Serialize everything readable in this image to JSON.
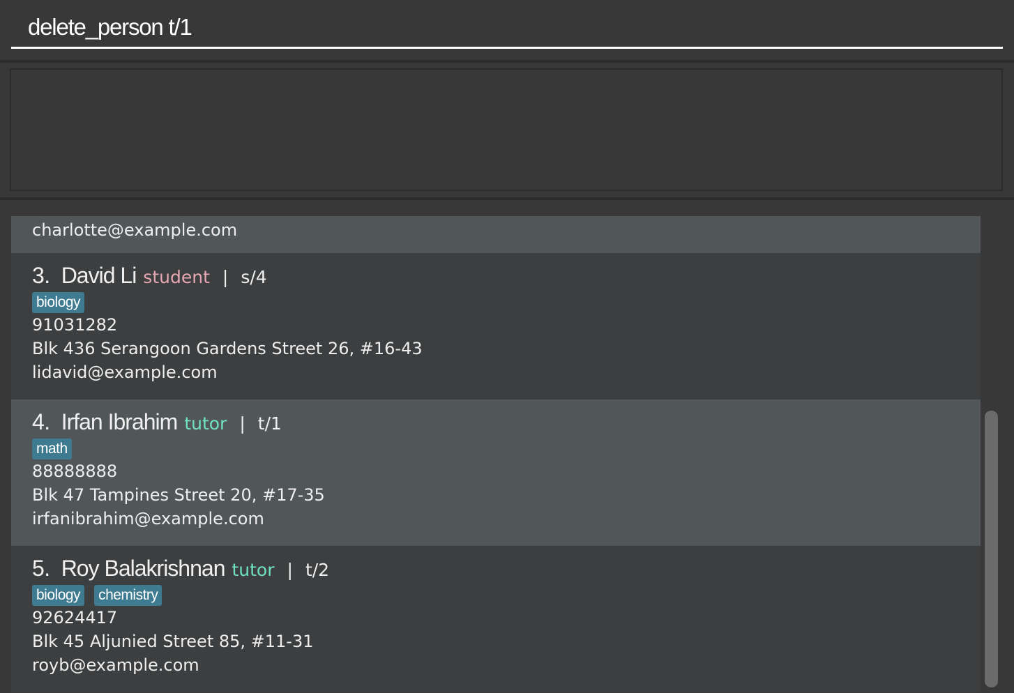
{
  "command": {
    "value": "delete_person t/1",
    "placeholder": ""
  },
  "result_display": {
    "text": ""
  },
  "partial_card": {
    "email": "charlotte@example.com"
  },
  "persons": [
    {
      "index": "3.",
      "name": "David Li",
      "role": "student",
      "separator": "|",
      "code": "s/4",
      "tags": [
        "biology"
      ],
      "phone": "91031282",
      "address": "Blk 436 Serangoon Gardens Street 26, #16-43",
      "email": "lidavid@example.com"
    },
    {
      "index": "4.",
      "name": "Irfan Ibrahim",
      "role": "tutor",
      "separator": "|",
      "code": "t/1",
      "tags": [
        "math"
      ],
      "phone": "88888888",
      "address": "Blk 47 Tampines Street 20, #17-35",
      "email": "irfanibrahim@example.com"
    },
    {
      "index": "5.",
      "name": "Roy Balakrishnan",
      "role": "tutor",
      "separator": "|",
      "code": "t/2",
      "tags": [
        "biology",
        "chemistry"
      ],
      "phone": "92624417",
      "address": "Blk 45 Aljunied Street 85, #11-31",
      "email": "royb@example.com"
    }
  ],
  "colors": {
    "background": "#383838",
    "card_odd": "#515658",
    "card_even": "#3c3e3f",
    "tag": "#3e7b91",
    "student": "#e6a8b4",
    "tutor": "#6fe3c1"
  }
}
